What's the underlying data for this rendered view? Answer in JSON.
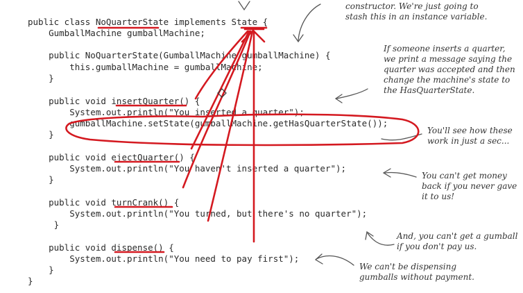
{
  "code": {
    "lines": [
      "public class NoQuarterState implements State {",
      "    GumballMachine gumballMachine;",
      "",
      "    public NoQuarterState(GumballMachine gumballMachine) {",
      "        this.gumballMachine = gumballMachine;",
      "    }",
      "",
      "    public void insertQuarter() {",
      "        System.out.println(\"You inserted a quarter\");",
      "        gumballMachine.setState(gumballMachine.getHasQuarterState());",
      "    }",
      "",
      "    public void ejectQuarter() {",
      "        System.out.println(\"You haven't inserted a quarter\");",
      "    }",
      "",
      "    public void turnCrank() {",
      "        System.out.println(\"You turned, but there's no quarter\");",
      "     }",
      "",
      "    public void dispense() {",
      "        System.out.println(\"You need to pay first\");",
      "    }",
      "}"
    ]
  },
  "annotations": {
    "constructor": "constructor. We're just going to\nstash this in an instance variable.",
    "insert": "If someone inserts a quarter,\nwe print a message saying the\nquarter was accepted and then\nchange the machine's state to\nthe HasQuarterState.",
    "see_how": "You'll see how these\nwork in just a sec...",
    "no_money": "You can't get money\nback if you never gave\nit to us!",
    "no_gumball": "And, you can't get a gumball\nif you don't pay us.",
    "dispensing": "We can't be dispensing\ngumballs without payment."
  },
  "colors": {
    "ink": "#d41920",
    "code": "#2a2a2a",
    "note": "#333333",
    "arrow": "#555555"
  }
}
